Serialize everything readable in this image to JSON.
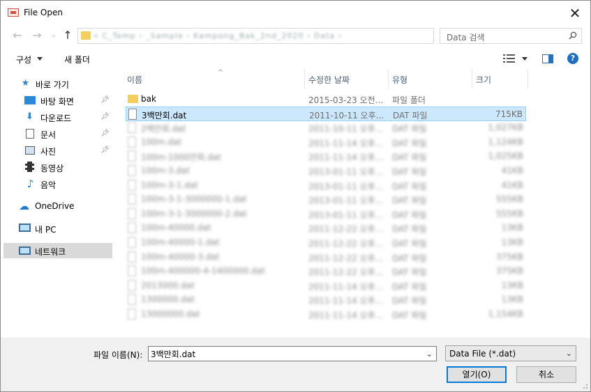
{
  "window": {
    "title": "File Open"
  },
  "navigation": {
    "address_path": "« C_Temp › _Sample › Kampong_Bak_2nd_2020 › Data ›",
    "search_placeholder": "Data 검색"
  },
  "toolbar": {
    "organize_label": "구성",
    "new_folder_label": "새 폴더",
    "help_label": "?"
  },
  "sidebar": {
    "items": [
      {
        "label": "바로 가기",
        "icon": "star-icon",
        "pinned": false
      },
      {
        "label": "바탕 화면",
        "icon": "desktop-icon",
        "pinned": true
      },
      {
        "label": "다운로드",
        "icon": "download-icon",
        "pinned": true
      },
      {
        "label": "문서",
        "icon": "document-icon",
        "pinned": true
      },
      {
        "label": "사진",
        "icon": "pictures-icon",
        "pinned": true
      },
      {
        "label": "동영상",
        "icon": "video-icon",
        "pinned": false
      },
      {
        "label": "음악",
        "icon": "music-icon",
        "pinned": false
      },
      {
        "label": "OneDrive",
        "icon": "cloud-icon",
        "pinned": false
      },
      {
        "label": "내 PC",
        "icon": "computer-icon",
        "pinned": false
      },
      {
        "label": "네트워크",
        "icon": "network-icon",
        "pinned": false,
        "selected": true
      }
    ]
  },
  "filelist": {
    "columns": [
      "이름",
      "수정한 날짜",
      "유형",
      "크기"
    ],
    "rows": [
      {
        "name": "bak",
        "date": "2015-03-23 오전...",
        "type": "파일 폴더",
        "size": "",
        "kind": "folder"
      },
      {
        "name": "3백만회.dat",
        "date": "2011-10-11 오후...",
        "type": "DAT 파일",
        "size": "715KB",
        "kind": "file",
        "selected": true
      },
      {
        "name": "2백만회.dat",
        "date": "2011-10-11 오후...",
        "type": "DAT 파일",
        "size": "1,027KB",
        "kind": "file"
      },
      {
        "name": "100m.dat",
        "date": "2011-11-14 오후...",
        "type": "DAT 파일",
        "size": "1,124KB",
        "kind": "file"
      },
      {
        "name": "100m-1000만회.dat",
        "date": "2011-11-14 오후...",
        "type": "DAT 파일",
        "size": "1,025KB",
        "kind": "file"
      },
      {
        "name": "100m-3.dat",
        "date": "2013-01-11 오후...",
        "type": "DAT 파일",
        "size": "41KB",
        "kind": "file"
      },
      {
        "name": "100m-3-1.dat",
        "date": "2013-01-11 오후...",
        "type": "DAT 파일",
        "size": "41KB",
        "kind": "file"
      },
      {
        "name": "100m-3-1-3000000-1.dat",
        "date": "2013-01-11 오후...",
        "type": "DAT 파일",
        "size": "555KB",
        "kind": "file"
      },
      {
        "name": "100m-3-1-3000000-2.dat",
        "date": "2013-01-11 오후...",
        "type": "DAT 파일",
        "size": "555KB",
        "kind": "file"
      },
      {
        "name": "100m-40000.dat",
        "date": "2011-12-22 오후...",
        "type": "DAT 파일",
        "size": "13KB",
        "kind": "file"
      },
      {
        "name": "100m-40000-1.dat",
        "date": "2011-12-22 오후...",
        "type": "DAT 파일",
        "size": "13KB",
        "kind": "file"
      },
      {
        "name": "100m-40000-3.dat",
        "date": "2011-12-22 오후...",
        "type": "DAT 파일",
        "size": "375KB",
        "kind": "file"
      },
      {
        "name": "100m-400000-4-1400000.dat",
        "date": "2011-12-22 오후...",
        "type": "DAT 파일",
        "size": "375KB",
        "kind": "file"
      },
      {
        "name": "2013000.dat",
        "date": "2011-11-14 오후...",
        "type": "DAT 파일",
        "size": "13KB",
        "kind": "file"
      },
      {
        "name": "1300000.dat",
        "date": "2011-11-14 오후...",
        "type": "DAT 파일",
        "size": "13KB",
        "kind": "file"
      },
      {
        "name": "13000000.dat",
        "date": "2011-11-14 오후...",
        "type": "DAT 파일",
        "size": "1,154KB",
        "kind": "file"
      }
    ]
  },
  "footer": {
    "filename_label": "파일 이름(N):",
    "filename_value": "3백만회.dat",
    "filter_value": "Data File (*.dat)",
    "open_label": "열기(O)",
    "cancel_label": "취소"
  },
  "colors": {
    "accent": "#0078d7",
    "selection": "#cce8ff",
    "folder": "#f4cf5b"
  }
}
